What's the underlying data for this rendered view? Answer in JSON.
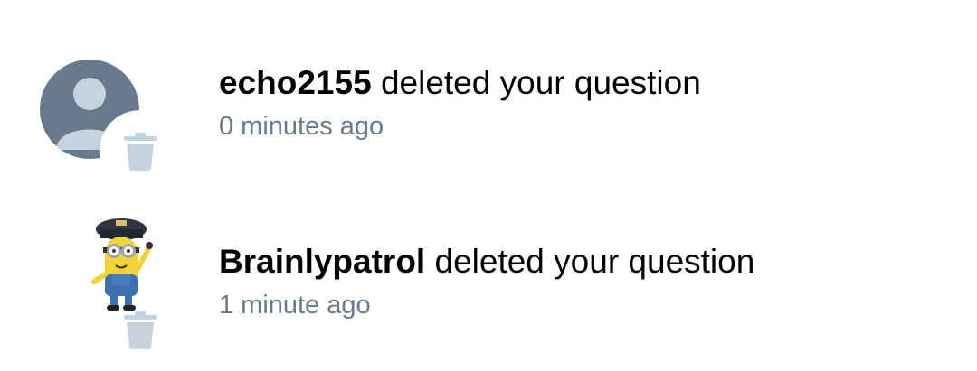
{
  "notifications": [
    {
      "username": "echo2155",
      "action": "deleted your question",
      "time": "0 minutes ago",
      "avatar": "default-user-icon",
      "badge_icon": "trash-icon"
    },
    {
      "username": "Brainlypatrol",
      "action": "deleted your question",
      "time": "1 minute ago",
      "avatar": "minion-police-avatar",
      "badge_icon": "trash-icon"
    }
  ],
  "colors": {
    "avatar_bg": "#687b8c",
    "avatar_figure": "#c4d3de",
    "trash": "#c4d3de",
    "time_text": "#687b8c",
    "main_text": "#000000"
  }
}
